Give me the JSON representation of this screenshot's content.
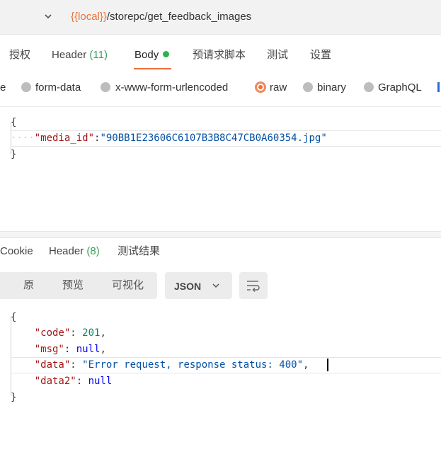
{
  "url_bar": {
    "variable": "{{local}}",
    "path": "/storepc/get_feedback_images"
  },
  "request_tabs": [
    {
      "label": "授权"
    },
    {
      "label": "Header",
      "count": "(11)"
    },
    {
      "label": "Body"
    },
    {
      "label": "预请求脚本"
    },
    {
      "label": "测试"
    },
    {
      "label": "设置"
    }
  ],
  "body_types": [
    {
      "label": "e"
    },
    {
      "label": "form-data"
    },
    {
      "label": "x-www-form-urlencoded"
    },
    {
      "label": "raw",
      "selected": true
    },
    {
      "label": "binary"
    },
    {
      "label": "GraphQL"
    }
  ],
  "request_body": {
    "open_brace": "{",
    "indent": "····",
    "key": "\"media_id\"",
    "colon": ":",
    "value": "\"90BB1E23606C6107B3B8C47CB0A60354.jpg\"",
    "close_brace": "}"
  },
  "response_tabs": [
    {
      "label": "Cookie"
    },
    {
      "label": "Header",
      "count": "(8)"
    },
    {
      "label": "测试结果"
    }
  ],
  "response_view": {
    "modes": [
      "原",
      "预览",
      "可视化"
    ],
    "format": "JSON"
  },
  "response_body": {
    "open_brace": "{",
    "close_brace": "}",
    "lines": [
      {
        "key": "\"code\"",
        "sep": ": ",
        "value": "201",
        "value_type": "number",
        "comma": ","
      },
      {
        "key": "\"msg\"",
        "sep": ": ",
        "value": "null",
        "value_type": "keyword",
        "comma": ","
      },
      {
        "key": "\"data\"",
        "sep": ": ",
        "value": "\"Error request, response status: 400\"",
        "value_type": "string",
        "comma": ","
      },
      {
        "key": "\"data2\"",
        "sep": ": ",
        "value": "null",
        "value_type": "keyword",
        "comma": ""
      }
    ]
  },
  "colors": {
    "accent": "#ef6c3c",
    "status_dot": "#2bb24c",
    "count_green": "#3f9e5b",
    "json_key": "#a31515",
    "json_string": "#0451a5",
    "json_number": "#098658",
    "json_keyword": "#0000ff"
  }
}
